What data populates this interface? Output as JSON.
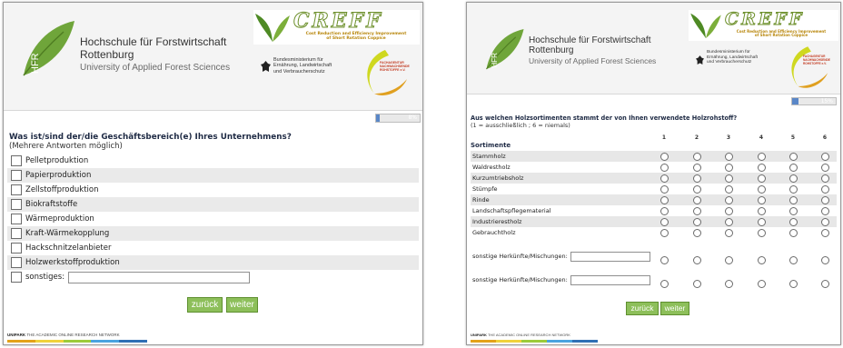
{
  "university": {
    "name_line1": "Hochschule für Forstwirtschaft",
    "name_line2": "Rottenburg",
    "name_line3": "University of Applied Forest Sciences",
    "logo_letters": "HFR"
  },
  "creff": {
    "title": "CREFF",
    "subtitle_line1": "Cost Reduction and Efficiency Improvement",
    "subtitle_line2": "of Short Rotation Coppice"
  },
  "ministry": {
    "line1": "Bundesministerium für",
    "line2": "Ernährung, Landwirtschaft",
    "line3": "und Verbraucherschutz"
  },
  "fnr_logo": {
    "line1": "FACHAGENTUR",
    "line2": "NACHWACHSENDE",
    "line3": "ROHSTOFFE e.V."
  },
  "left_page": {
    "progress": {
      "percent": 8,
      "label": "8%"
    },
    "question": "Was ist/sind der/die Geschäftsbereich(e) Ihres Unternehmens?",
    "hint": "(Mehrere Antworten möglich)",
    "options": [
      "Pelletproduktion",
      "Papierproduktion",
      "Zellstoffproduktion",
      "Biokraftstoffe",
      "Wärmeproduktion",
      "Kraft-Wärmekopplung",
      "Hackschnitzelanbieter",
      "Holzwerkstoffproduktion"
    ],
    "other_label": "sonstiges:",
    "other_value": "",
    "back_button": "zurück",
    "next_button": "weiter"
  },
  "right_page": {
    "progress": {
      "percent": 15,
      "label": "15%"
    },
    "question": "Aus welchen Holzsortimenten stammt der von Ihnen verwendete Holzrohstoff?",
    "hint": "(1 = ausschließlich ; 6 = niemals)",
    "row_header": "Sortimente",
    "scale": [
      "1",
      "2",
      "3",
      "4",
      "5",
      "6"
    ],
    "rows": [
      "Stammholz",
      "Waldrestholz",
      "Kurzumtriebsholz",
      "Stümpfe",
      "Rinde",
      "Landschaftspflegematerial",
      "Industrierestholz",
      "Gebrauchtholz"
    ],
    "other_rows": [
      {
        "label": "sonstige Herkünfte/Mischungen:",
        "value": ""
      },
      {
        "label": "sonstige Herkünfte/Mischungen:",
        "value": ""
      }
    ],
    "back_button": "zurück",
    "next_button": "weiter"
  },
  "footer": {
    "brand": "UNIPARK",
    "tagline": "THE ACADEMIC ONLINE RESEARCH NETWORK",
    "bar_colors": [
      "#e3a21a",
      "#f0d23c",
      "#9ccb3b",
      "#4aa3df",
      "#2f6fb4"
    ]
  },
  "colors": {
    "brand_green": "#8dbf5a",
    "progress_blue": "#5a87c8",
    "row_shade": "#eaeaea"
  }
}
